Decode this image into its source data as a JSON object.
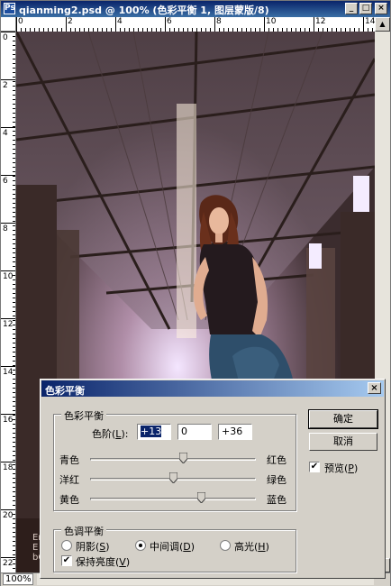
{
  "window": {
    "title": "qianming2.psd @ 100% (色彩平衡 1, 图层蒙版/8)",
    "minimize": "_",
    "maximize": "□",
    "close": "×",
    "zoom": "100%"
  },
  "rulers": {
    "top": [
      "0",
      "2",
      "4",
      "6",
      "8",
      "10",
      "12",
      "14"
    ],
    "left": [
      "0",
      "2",
      "4",
      "6",
      "8",
      "10",
      "12",
      "14",
      "16",
      "18",
      "20",
      "22"
    ]
  },
  "canvas": {
    "text_lines": [
      "Em",
      "E",
      "bC"
    ]
  },
  "dialog": {
    "title": "色彩平衡",
    "close": "×",
    "balance_group": "色彩平衡",
    "levels_label_pre": "色阶(",
    "levels_label_key": "L",
    "levels_label_post": "):",
    "level1": "+13",
    "level2": "0",
    "level3": "+36",
    "slider_rows": [
      {
        "left": "青色",
        "right": "红色",
        "value": 13
      },
      {
        "left": "洋红",
        "right": "绿色",
        "value": 0
      },
      {
        "left": "黄色",
        "right": "蓝色",
        "value": 36
      }
    ],
    "tone_group": "色调平衡",
    "shadows_pre": "阴影(",
    "shadows_key": "S",
    "shadows_post": ")",
    "midtones_pre": "中间调(",
    "midtones_key": "D",
    "midtones_post": ")",
    "highlights_pre": "高光(",
    "highlights_key": "H",
    "highlights_post": ")",
    "preserve_pre": "保持亮度(",
    "preserve_key": "V",
    "preserve_post": ")",
    "ok": "确定",
    "cancel": "取消",
    "preview_pre": "预览(",
    "preview_key": "P",
    "preview_post": ")",
    "check_glyph": "✔"
  },
  "colors": {
    "titlebar": "#0a246a",
    "dialog_bg": "#d4d0c8"
  }
}
